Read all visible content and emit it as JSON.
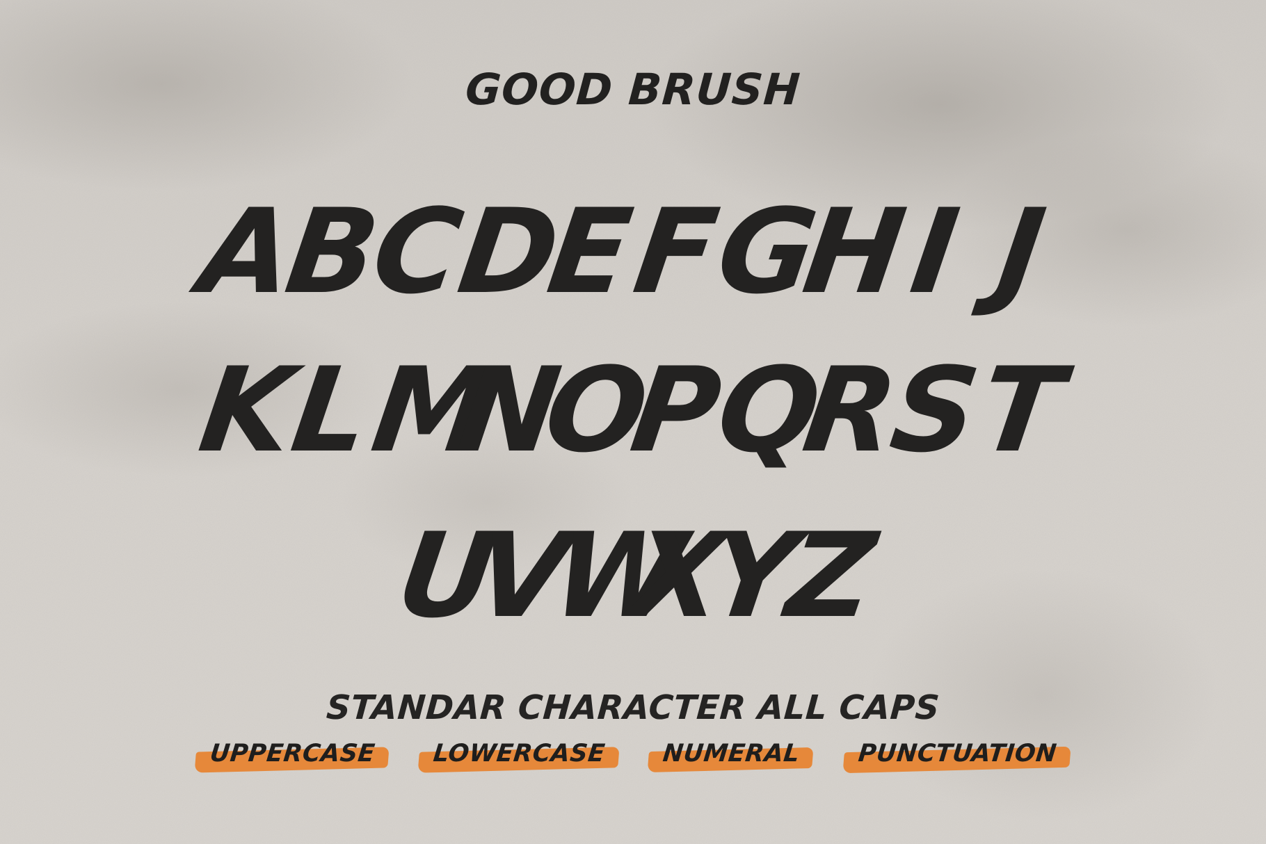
{
  "title": "GOOD BRUSH",
  "alphabet": {
    "row1": [
      "A",
      "B",
      "C",
      "D",
      "E",
      "F",
      "G",
      "H",
      "I",
      "J"
    ],
    "row2": [
      "K",
      "L",
      "M",
      "N",
      "O",
      "P",
      "Q",
      "R",
      "S",
      "T"
    ],
    "row3": [
      "U",
      "V",
      "W",
      "X",
      "Y",
      "Z"
    ]
  },
  "subtitle": "STANDAR CHARACTER ALL CAPS",
  "tags": [
    "UPPERCASE",
    "LOWERCASE",
    "NUMERAL",
    "PUNCTUATION"
  ],
  "colors": {
    "background": "#d4d0cb",
    "ink": "#232221",
    "accent": "#e6883a"
  }
}
